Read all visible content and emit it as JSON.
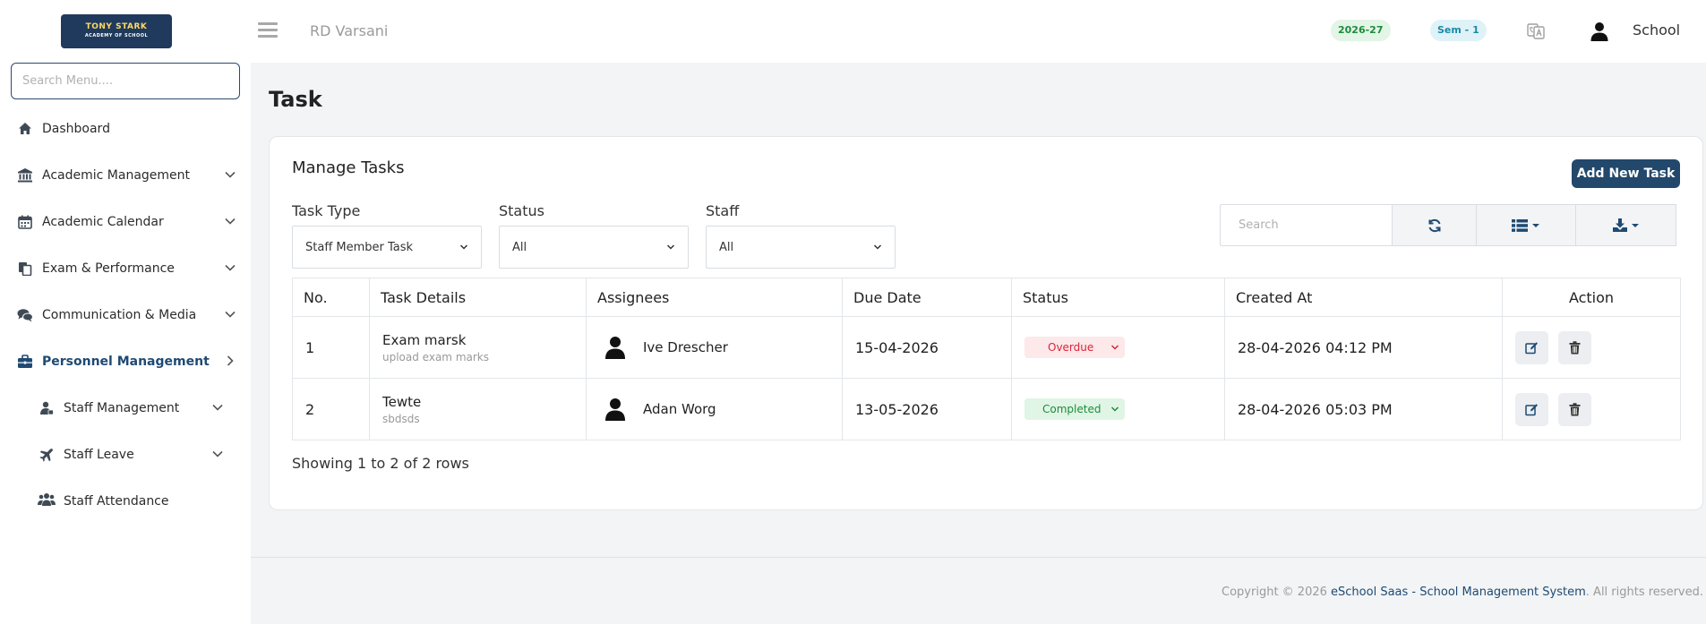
{
  "sidebar": {
    "logo_text": "TONY STARK",
    "logo_sub": "ACADEMY OF SCHOOL",
    "search_placeholder": "Search Menu....",
    "items": [
      {
        "label": "Dashboard",
        "icon": "home-icon"
      },
      {
        "label": "Academic Management",
        "icon": "bank-icon"
      },
      {
        "label": "Academic Calendar",
        "icon": "calendar-icon"
      },
      {
        "label": "Exam & Performance",
        "icon": "copy-icon"
      },
      {
        "label": "Communication & Media",
        "icon": "chat-icon"
      },
      {
        "label": "Personnel Management",
        "icon": "briefcase-icon"
      },
      {
        "label": "Staff Management",
        "icon": "user-lock-icon"
      },
      {
        "label": "Staff Leave",
        "icon": "plane-icon"
      },
      {
        "label": "Staff Attendance",
        "icon": "users-icon"
      }
    ]
  },
  "topbar": {
    "school": "RD Varsani",
    "year": "2026-27",
    "semester": "Sem - 1",
    "user": "School"
  },
  "page": {
    "title": "Task",
    "card_title": "Manage Tasks",
    "add_button": "Add New Task"
  },
  "filters": {
    "task_type": {
      "label": "Task Type",
      "value": "Staff Member Task"
    },
    "status": {
      "label": "Status",
      "value": "All"
    },
    "staff": {
      "label": "Staff",
      "value": "All"
    }
  },
  "toolbar": {
    "search_placeholder": "Search"
  },
  "table": {
    "headers": [
      "No.",
      "Task Details",
      "Assignees",
      "Due Date",
      "Status",
      "Created At",
      "Action"
    ],
    "rows": [
      {
        "no": "1",
        "title": "Exam marsk",
        "desc": "upload exam marks",
        "assignee": "Ive Drescher",
        "due": "15-04-2026",
        "status": "Overdue",
        "created": "28-04-2026 04:12 PM"
      },
      {
        "no": "2",
        "title": "Tewte",
        "desc": "sbdsds",
        "assignee": "Adan Worg",
        "due": "13-05-2026",
        "status": "Completed",
        "created": "28-04-2026 05:03 PM"
      }
    ],
    "showing": "Showing 1 to 2 of 2 rows"
  },
  "footer": {
    "prefix": "Copyright © 2026 ",
    "link": "eSchool Saas - School Management System",
    "suffix": ". All rights reserved."
  }
}
